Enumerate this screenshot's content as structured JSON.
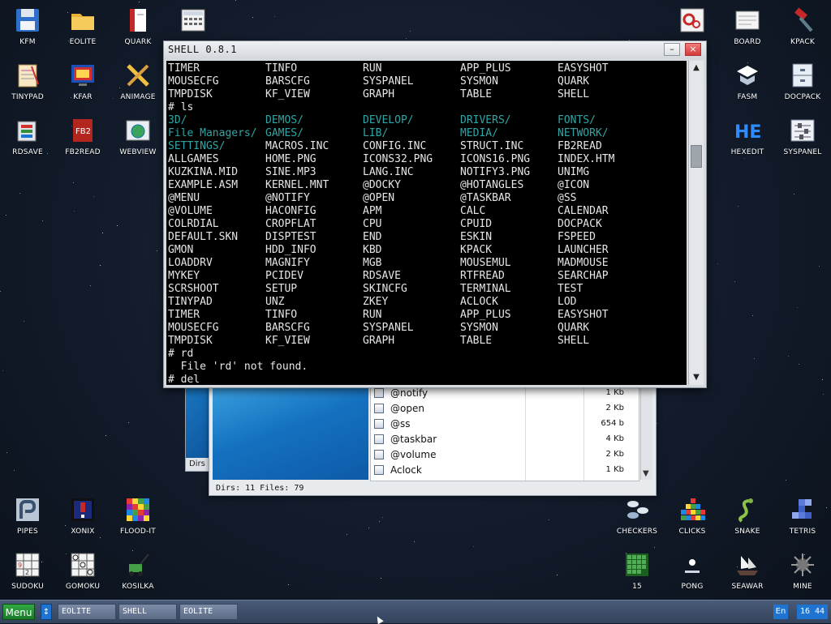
{
  "desktop": {
    "icons_left": [
      {
        "label": "KFM",
        "icon": "floppy-icon"
      },
      {
        "label": "EOLITE",
        "icon": "folder-icon"
      },
      {
        "label": "QUARK",
        "icon": "document-red-icon"
      },
      {
        "label": "TINYPAD",
        "icon": "notepad-icon"
      },
      {
        "label": "KFAR",
        "icon": "monitor-blue-icon"
      },
      {
        "label": "ANIMAGE",
        "icon": "pencil-icon"
      },
      {
        "label": "RDSAVE",
        "icon": "disk-save-icon"
      },
      {
        "label": "FB2READ",
        "icon": "fb2-book-icon"
      },
      {
        "label": "WEBVIEW",
        "icon": "globe-window-icon"
      }
    ],
    "icons_right": [
      {
        "label": "BOARD",
        "icon": "board-icon"
      },
      {
        "label": "KPACK",
        "icon": "hammer-icon"
      },
      {
        "label": "FASM",
        "icon": "fasm-icon"
      },
      {
        "label": "DOCPACK",
        "icon": "drawer-icon"
      },
      {
        "label": "HEXEDIT",
        "icon": "hexedit-icon"
      },
      {
        "label": "SYSPANEL",
        "icon": "sliders-icon"
      }
    ],
    "icons_bottom": [
      {
        "label": "PIPES",
        "icon": "pipes-icon"
      },
      {
        "label": "XONIX",
        "icon": "xonix-icon"
      },
      {
        "label": "FLOOD-IT",
        "icon": "flood-it-icon"
      },
      {
        "label": "SUDOKU",
        "icon": "sudoku-icon"
      },
      {
        "label": "GOMOKU",
        "icon": "gomoku-icon"
      },
      {
        "label": "KOSILKA",
        "icon": "lawnmower-icon"
      },
      {
        "label": "CHECKERS",
        "icon": "checkers-icon"
      },
      {
        "label": "CLICKS",
        "icon": "clicks-icon"
      },
      {
        "label": "SNAKE",
        "icon": "snake-icon"
      },
      {
        "label": "TETRIS",
        "icon": "tetris-icon"
      },
      {
        "label": "15",
        "icon": "fifteen-icon"
      },
      {
        "label": "PONG",
        "icon": "pong-icon"
      },
      {
        "label": "SEAWAR",
        "icon": "ship-icon"
      },
      {
        "label": "MINE",
        "icon": "mine-icon"
      }
    ]
  },
  "file_manager": {
    "rows": [
      {
        "name": "@notify",
        "size": "1 Kb"
      },
      {
        "name": "@open",
        "size": "2 Kb"
      },
      {
        "name": "@ss",
        "size": "654 b"
      },
      {
        "name": "@taskbar",
        "size": "4 Kb"
      },
      {
        "name": "@volume",
        "size": "2 Kb"
      },
      {
        "name": "Aclock",
        "size": "1 Kb"
      }
    ],
    "status": "Dirs: 11  Files: 79",
    "back_status": "Dirs"
  },
  "shell": {
    "title": "SHELL 0.8.1",
    "lines": [
      {
        "cols": [
          "TIMER",
          "TINFO",
          "RUN",
          "APP_PLUS",
          "EASYSHOT"
        ]
      },
      {
        "cols": [
          "MOUSECFG",
          "BARSCFG",
          "SYSPANEL",
          "SYSMON",
          "QUARK"
        ]
      },
      {
        "cols": [
          "TMPDISK",
          "KF_VIEW",
          "GRAPH",
          "TABLE",
          "SHELL"
        ]
      },
      {
        "text": "# ls"
      },
      {
        "cols": [
          "3D/",
          "DEMOS/",
          "DEVELOP/",
          "DRIVERS/",
          "FONTS/"
        ],
        "dirs": [
          0,
          1,
          2,
          3,
          4
        ]
      },
      {
        "cols": [
          "File Managers/",
          "GAMES/",
          "LIB/",
          "MEDIA/",
          "NETWORK/"
        ],
        "dirs": [
          0,
          1,
          2,
          3,
          4
        ]
      },
      {
        "cols": [
          "SETTINGS/",
          "MACROS.INC",
          "CONFIG.INC",
          "STRUCT.INC",
          "FB2READ"
        ],
        "dirs": [
          0
        ]
      },
      {
        "cols": [
          "ALLGAMES",
          "HOME.PNG",
          "ICONS32.PNG",
          "ICONS16.PNG",
          "INDEX.HTM"
        ]
      },
      {
        "cols": [
          "KUZKINA.MID",
          "SINE.MP3",
          "LANG.INC",
          "NOTIFY3.PNG",
          "UNIMG"
        ]
      },
      {
        "cols": [
          "EXAMPLE.ASM",
          "KERNEL.MNT",
          "@DOCKY",
          "@HOTANGLES",
          "@ICON"
        ]
      },
      {
        "cols": [
          "@MENU",
          "@NOTIFY",
          "@OPEN",
          "@TASKBAR",
          "@SS"
        ]
      },
      {
        "cols": [
          "@VOLUME",
          "HACONFIG",
          "APM",
          "CALC",
          "CALENDAR"
        ]
      },
      {
        "cols": [
          "COLRDIAL",
          "CROPFLAT",
          "CPU",
          "CPUID",
          "DOCPACK"
        ]
      },
      {
        "cols": [
          "DEFAULT.SKN",
          "DISPTEST",
          "END",
          "ESKIN",
          "FSPEED"
        ]
      },
      {
        "cols": [
          "GMON",
          "HDD_INFO",
          "KBD",
          "KPACK",
          "LAUNCHER"
        ]
      },
      {
        "cols": [
          "LOADDRV",
          "MAGNIFY",
          "MGB",
          "MOUSEMUL",
          "MADMOUSE"
        ]
      },
      {
        "cols": [
          "MYKEY",
          "PCIDEV",
          "RDSAVE",
          "RTFREAD",
          "SEARCHAP"
        ]
      },
      {
        "cols": [
          "SCRSHOOT",
          "SETUP",
          "SKINCFG",
          "TERMINAL",
          "TEST"
        ]
      },
      {
        "cols": [
          "TINYPAD",
          "UNZ",
          "ZKEY",
          "ACLOCK",
          "LOD"
        ]
      },
      {
        "cols": [
          "TIMER",
          "TINFO",
          "RUN",
          "APP_PLUS",
          "EASYSHOT"
        ]
      },
      {
        "cols": [
          "MOUSECFG",
          "BARSCFG",
          "SYSPANEL",
          "SYSMON",
          "QUARK"
        ]
      },
      {
        "cols": [
          "TMPDISK",
          "KF_VIEW",
          "GRAPH",
          "TABLE",
          "SHELL"
        ]
      },
      {
        "text": "# rd"
      },
      {
        "text": "  File 'rd' not found."
      },
      {
        "text": "# del"
      }
    ],
    "minimize_glyph": "–",
    "close_glyph": "×"
  },
  "taskbar": {
    "menu_label": "Menu",
    "swap_glyph": "↕",
    "tasks": [
      "EOLITE",
      "SHELL",
      "EOLITE"
    ],
    "lang": "En",
    "clock": "16 44"
  },
  "colors": {
    "dir": "#2fa6a6",
    "terminal_bg": "#000000",
    "taskbar": "#3d4d68",
    "menu": "#25913a"
  }
}
